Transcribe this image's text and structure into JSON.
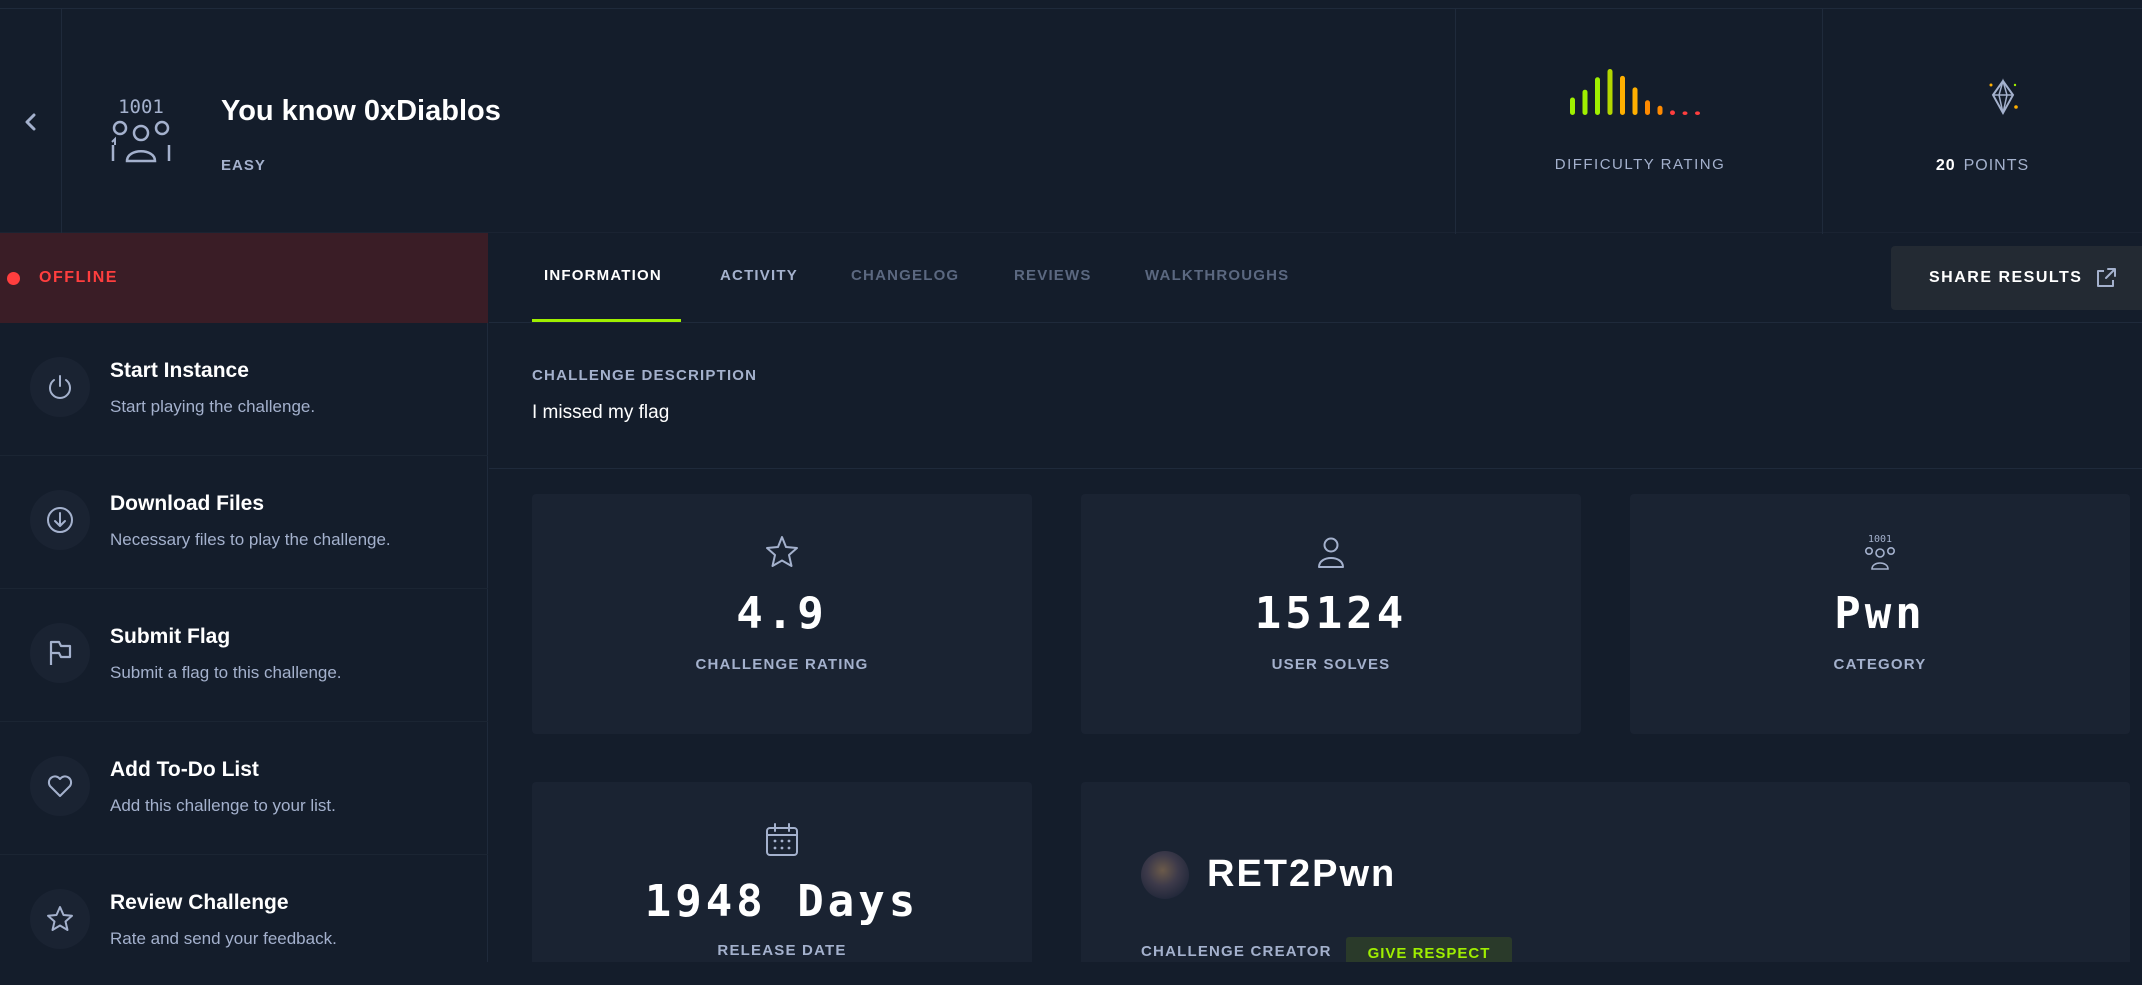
{
  "header": {
    "back_icon": "chevron-left-icon",
    "category_icon": "binary-user-icon",
    "title": "You know 0xDiablos",
    "difficulty": "EASY",
    "difficulty_rating_label": "DIFFICULTY RATING",
    "difficulty_bars": [
      {
        "level": 0.38,
        "color": "#9fef00"
      },
      {
        "level": 0.55,
        "color": "#9fef00"
      },
      {
        "level": 0.82,
        "color": "#9fef00"
      },
      {
        "level": 1.0,
        "color": "#b3d600"
      },
      {
        "level": 0.85,
        "color": "#ffaf00"
      },
      {
        "level": 0.6,
        "color": "#ffaf00"
      },
      {
        "level": 0.32,
        "color": "#ff8a00"
      },
      {
        "level": 0.2,
        "color": "#ff8a00"
      },
      {
        "level": 0.1,
        "color": "#ff3e3e"
      },
      {
        "level": 0.08,
        "color": "#ff3e3e"
      },
      {
        "level": 0.08,
        "color": "#ff3e3e"
      }
    ],
    "points_value": "20",
    "points_label": "POINTS",
    "points_icon": "crystal-icon"
  },
  "sidebar": {
    "status": "OFFLINE",
    "status_color": "#ff3e3e",
    "items": [
      {
        "title": "Start Instance",
        "subtitle": "Start playing the challenge.",
        "icon": "power-icon"
      },
      {
        "title": "Download Files",
        "subtitle": "Necessary files to play the challenge.",
        "icon": "download-icon"
      },
      {
        "title": "Submit Flag",
        "subtitle": "Submit a flag to this challenge.",
        "icon": "flag-icon"
      },
      {
        "title": "Add To-Do List",
        "subtitle": "Add this challenge to your list.",
        "icon": "heart-icon"
      },
      {
        "title": "Review Challenge",
        "subtitle": "Rate and send your feedback.",
        "icon": "star-icon"
      }
    ]
  },
  "tabs": [
    {
      "label": "INFORMATION",
      "state": "active"
    },
    {
      "label": "ACTIVITY",
      "state": "normal"
    },
    {
      "label": "CHANGELOG",
      "state": "dim"
    },
    {
      "label": "REVIEWS",
      "state": "dim"
    },
    {
      "label": "WALKTHROUGHS",
      "state": "dim"
    }
  ],
  "share": {
    "label": "SHARE RESULTS",
    "icon": "share-icon"
  },
  "description": {
    "label": "CHALLENGE DESCRIPTION",
    "text": "I missed my flag"
  },
  "stats": {
    "rating": {
      "value": "4.9",
      "label": "CHALLENGE RATING",
      "icon": "star-icon"
    },
    "solves": {
      "value": "15124",
      "label": "USER SOLVES",
      "icon": "user-icon"
    },
    "category": {
      "value": "Pwn",
      "label": "CATEGORY",
      "icon": "binary-user-icon"
    },
    "release": {
      "value": "1948 Days",
      "label": "RELEASE DATE",
      "icon": "calendar-icon"
    }
  },
  "creator": {
    "name": "RET2Pwn",
    "label": "CHALLENGE CREATOR",
    "respect_label": "GIVE RESPECT"
  },
  "colors": {
    "accent": "#9fef00",
    "background": "#141d2b",
    "card": "#1a2332",
    "muted_text": "#a4b1cd",
    "offline_bg": "#3a1d26"
  }
}
